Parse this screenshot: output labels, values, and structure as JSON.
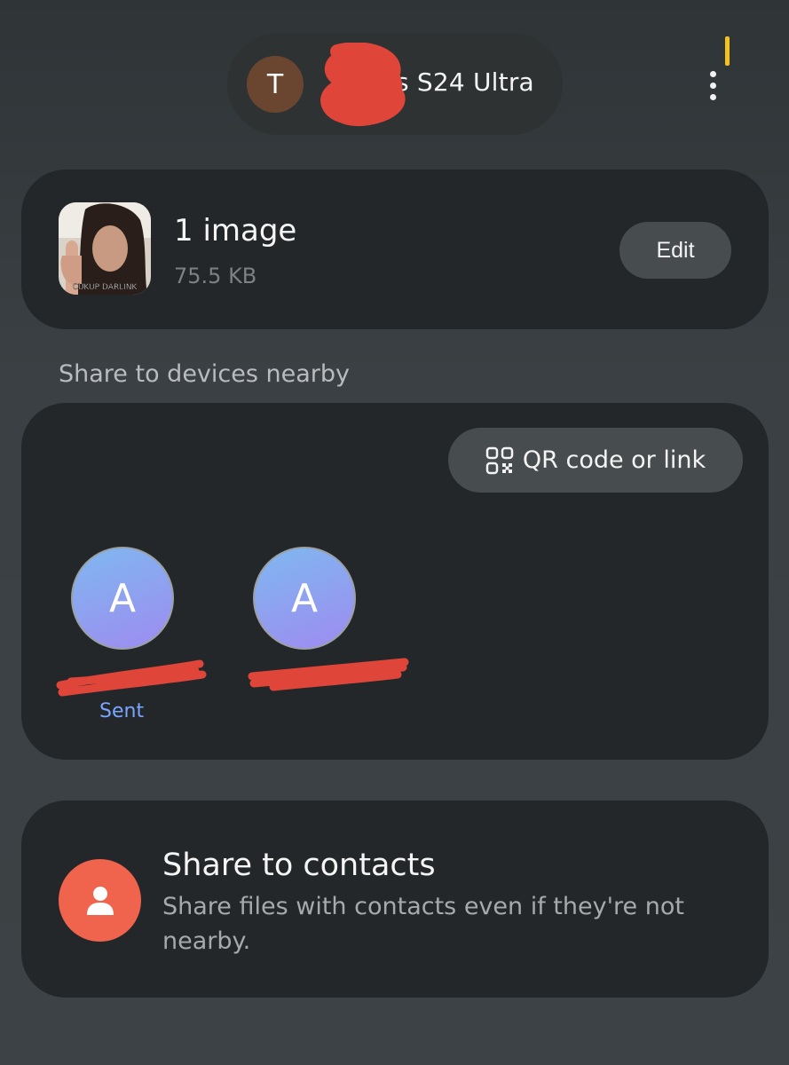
{
  "header": {
    "avatar_letter": "T",
    "device_name_visible": "s S24 Ultra",
    "more_options_icon": "more-vert-icon"
  },
  "file": {
    "title": "1 image",
    "size": "75.5 KB",
    "thumbnail_caption": "CUKUP DARLINK",
    "edit_label": "Edit"
  },
  "nearby": {
    "section_label": "Share to devices nearby",
    "qr_label": "QR code or link",
    "qr_icon": "qr-code-icon",
    "devices": [
      {
        "avatar_letter": "A",
        "status": "Sent"
      },
      {
        "avatar_letter": "A",
        "status": ""
      }
    ]
  },
  "contacts": {
    "title": "Share to contacts",
    "description": "Share files with contacts even if they're not nearby.",
    "icon": "person-icon"
  },
  "colors": {
    "accent_sent": "#7aa6ff",
    "contacts_icon_bg": "#f0634d",
    "redaction": "#e0453a",
    "status_indicator": "#f4c21c"
  }
}
